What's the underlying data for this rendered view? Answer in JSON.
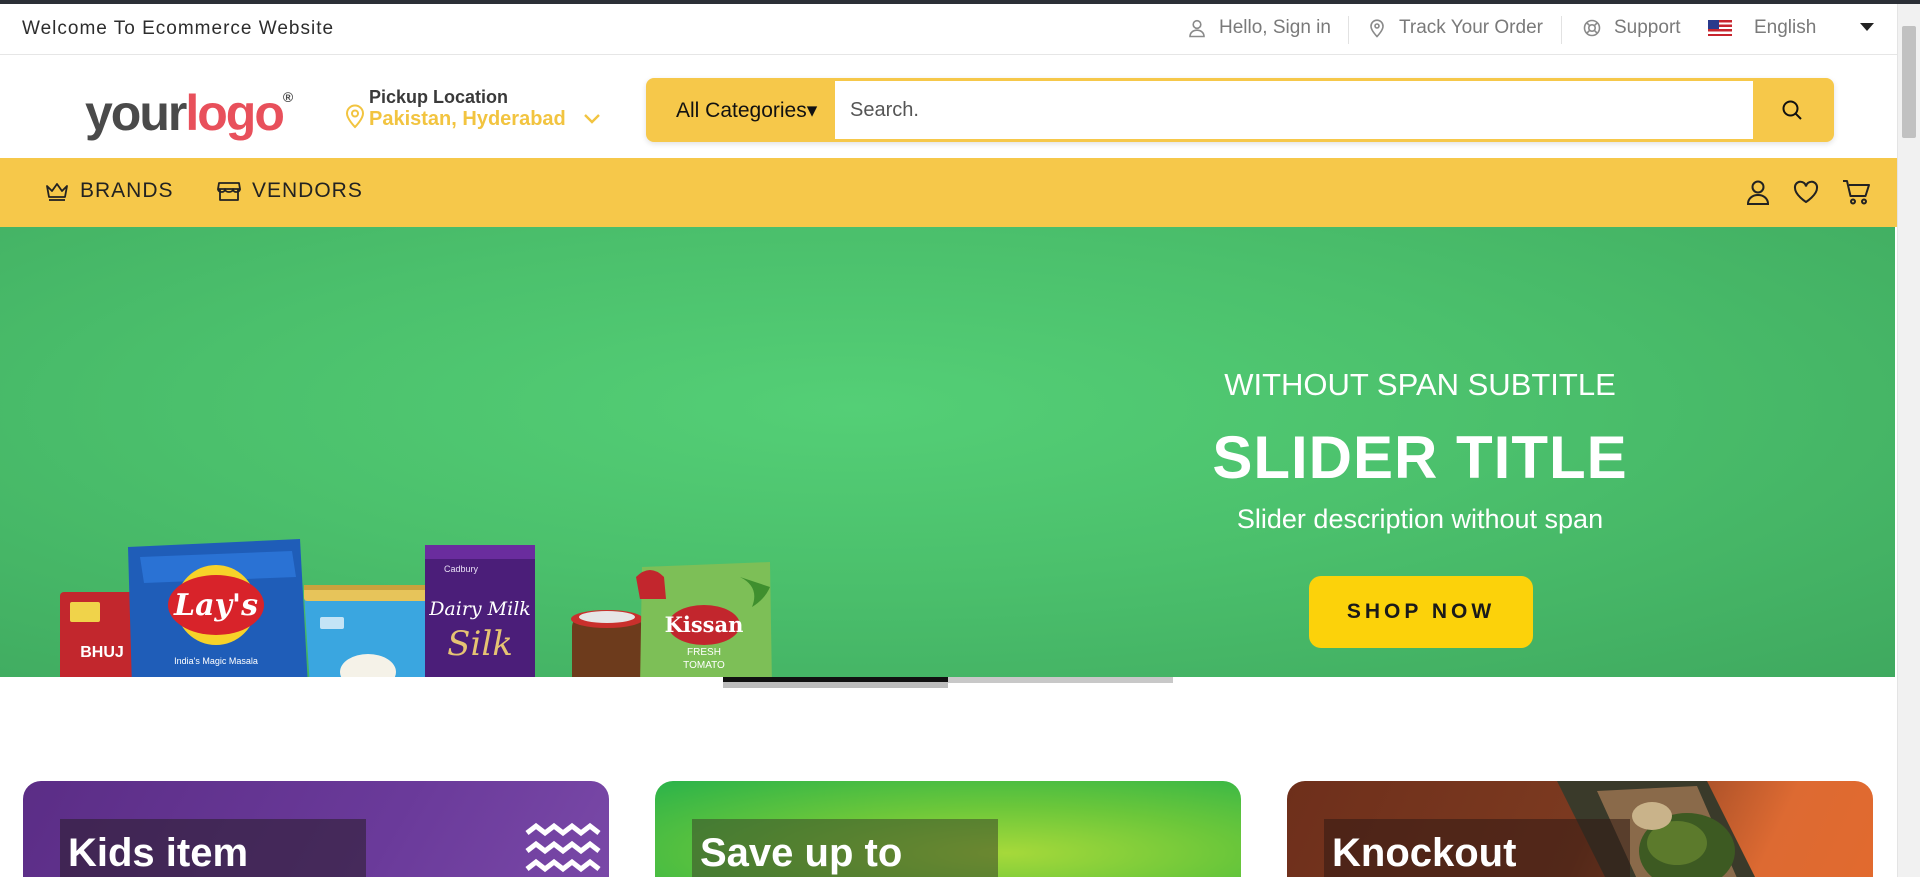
{
  "topbar": {
    "welcome": "Welcome To Ecommerce Website",
    "sign_in": "Hello, Sign in",
    "track_order": "Track Your Order",
    "support": "Support",
    "language": "English"
  },
  "header": {
    "logo_part1": "your",
    "logo_part2": "logo",
    "logo_reg": "®",
    "pickup_label": "Pickup Location",
    "pickup_value": "Pakistan, Hyderabad",
    "search_category": "All Categories",
    "search_category_caret": "▾",
    "search_placeholder": "Search."
  },
  "nav": {
    "brands": "BRANDS",
    "vendors": "VENDORS"
  },
  "hero": {
    "subtitle": "WITHOUT SPAN SUBTITLE",
    "title": "SLIDER TITLE",
    "description": "Slider description without span",
    "button": "SHOP NOW",
    "product_labels": {
      "bhujia": "BHUJ",
      "lays": "Lay's",
      "lays_tag": "India's Magic Masala",
      "silk_brand": "Cadbury",
      "silk_name": "Dairy Milk",
      "silk_sub": "Silk",
      "kissan": "Kissan",
      "kissan_sub1": "FRESH",
      "kissan_sub2": "TOMATO"
    },
    "active_slide": 1,
    "slide_count": 2
  },
  "cards": [
    {
      "label": "Kids item"
    },
    {
      "label": "Save up to"
    },
    {
      "label": "Knockout"
    }
  ],
  "colors": {
    "accent_yellow": "#f6c84a",
    "hero_green": "#4bc06c",
    "button_yellow": "#fcd20a",
    "pickup_text": "#f2c440"
  },
  "icons": {
    "sign_in": "user-icon",
    "track_order": "map-pin-icon",
    "support": "lifebuoy-icon",
    "language": "us-flag-icon",
    "search": "search-icon",
    "brands": "crown-icon",
    "vendors": "store-icon",
    "account": "user-icon",
    "wishlist": "heart-icon",
    "cart": "cart-icon"
  }
}
